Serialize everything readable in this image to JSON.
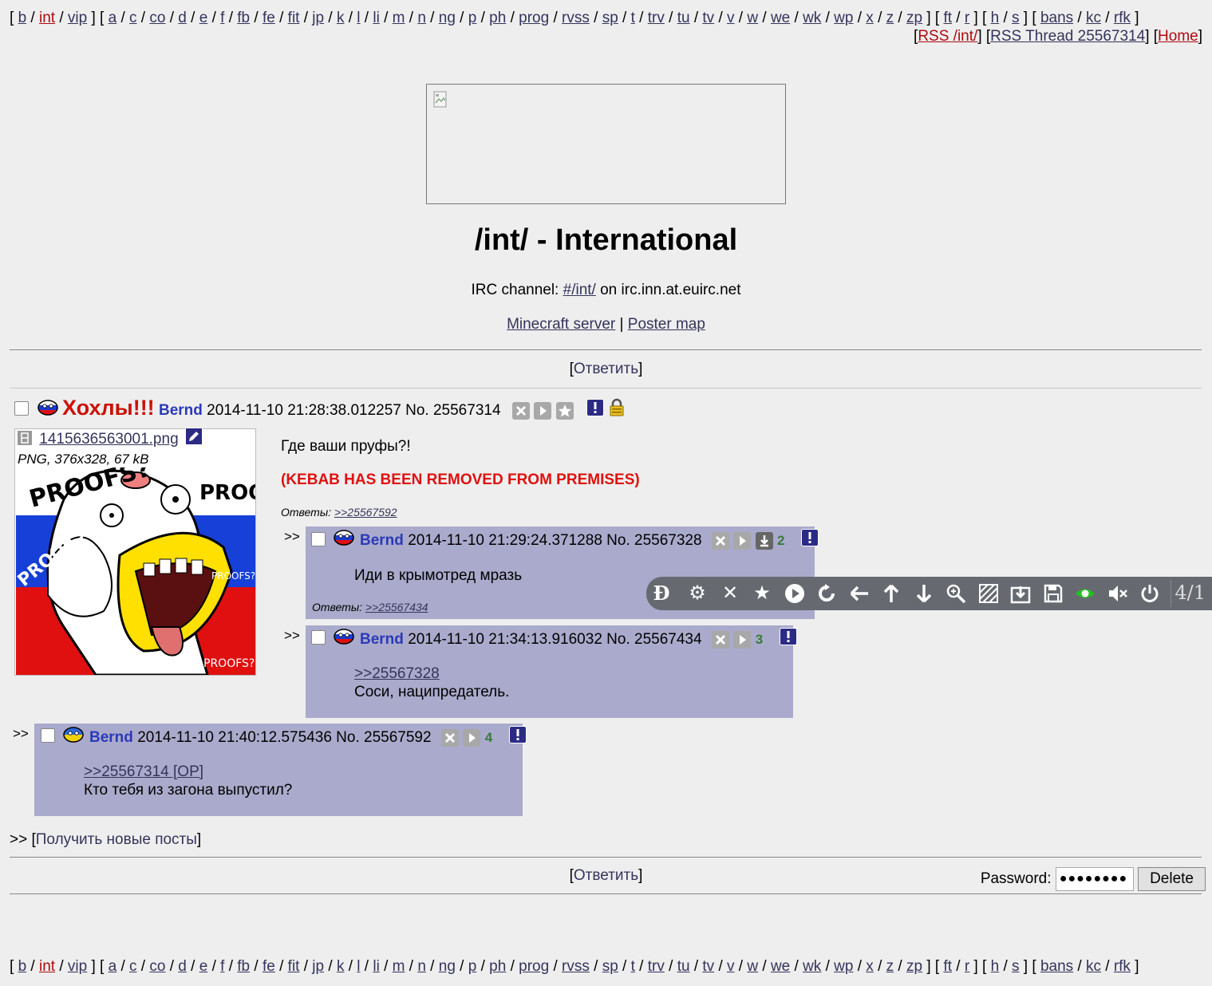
{
  "boardlist": {
    "groups": [
      [
        "b",
        "int",
        "vip"
      ],
      [
        "a",
        "c",
        "co",
        "d",
        "e",
        "f",
        "fb",
        "fe",
        "fit",
        "jp",
        "k",
        "l",
        "li",
        "m",
        "n",
        "ng",
        "p",
        "ph",
        "prog",
        "rvss",
        "sp",
        "t",
        "trv",
        "tu",
        "tv",
        "v",
        "w",
        "we",
        "wk",
        "wp",
        "x",
        "z",
        "zp"
      ],
      [
        "ft",
        "r"
      ],
      [
        "h",
        "s"
      ],
      [
        "bans",
        "kc",
        "rfk"
      ]
    ],
    "current": "int"
  },
  "toplinks": {
    "rss_board": "RSS /int/",
    "rss_thread": "RSS Thread 25567314",
    "home": "Home"
  },
  "header": {
    "title": "/int/ - International",
    "irc_prefix": "IRC channel: ",
    "irc_channel": "#/int/",
    "irc_suffix": " on irc.inn.at.euirc.net",
    "minecraft": "Minecraft server",
    "separator": " | ",
    "poster_map": "Poster map"
  },
  "reply_button": "Ответить",
  "op": {
    "subject": "Хохлы!!!",
    "name": "Bernd",
    "datetime": "2014-11-10 21:28:38.012257",
    "number": "No. 25567314",
    "file_name": "1415636563001.png",
    "file_info": "PNG, 376x328, 67 kB",
    "text": "Где ваши пруфы?!",
    "ban_notice": "(KEBAB HAS BEEN REMOVED FROM PREMISES)",
    "answers_label": "Ответы: ",
    "answers_link": ">>25567592",
    "image_text": [
      "PROOFS?",
      "PROOFS?",
      "PROOFS?",
      "PROOFS?",
      "PROOFS?"
    ]
  },
  "replies": [
    {
      "name": "Bernd",
      "datetime": "2014-11-10 21:29:24.371288",
      "number": "No. 25567328",
      "count": "2",
      "quote": "",
      "text": "Иди в крымотред мразь",
      "answers_label": "Ответы: ",
      "answers_link": ">>25567434"
    },
    {
      "name": "Bernd",
      "datetime": "2014-11-10 21:34:13.916032",
      "number": "No. 25567434",
      "count": "3",
      "quote": ">>25567328",
      "text": "Соси, наципредатель."
    },
    {
      "name": "Bernd",
      "datetime": "2014-11-10 21:40:12.575436",
      "number": "No. 25567592",
      "count": "4",
      "quote": ">>25567314 [OP]",
      "text": "Кто тебя из загона выпустил?"
    }
  ],
  "reply_arrow": ">>",
  "get_new_posts": "Получить новые посты",
  "footer": {
    "password_label": "Password:",
    "password_value": "●●●●●●●●",
    "delete_label": "Delete"
  },
  "toolbar": {
    "page_indicator": "4/1",
    "icons": [
      "de-logo-icon",
      "gear-icon",
      "close-icon",
      "star-icon",
      "play-icon",
      "refresh-icon",
      "arrow-left-icon",
      "arrow-up-icon",
      "arrow-down-icon",
      "zoom-icon",
      "hatch-icon",
      "download-icon",
      "save-icon",
      "eye-icon",
      "mute-icon",
      "power-icon"
    ]
  },
  "colors": {
    "background": "#eeeeee",
    "reply_bg": "#aaaacc",
    "subject": "#cc1105",
    "name": "#2a3ab8",
    "link": "#34345c",
    "red_link": "#af0a0f"
  }
}
